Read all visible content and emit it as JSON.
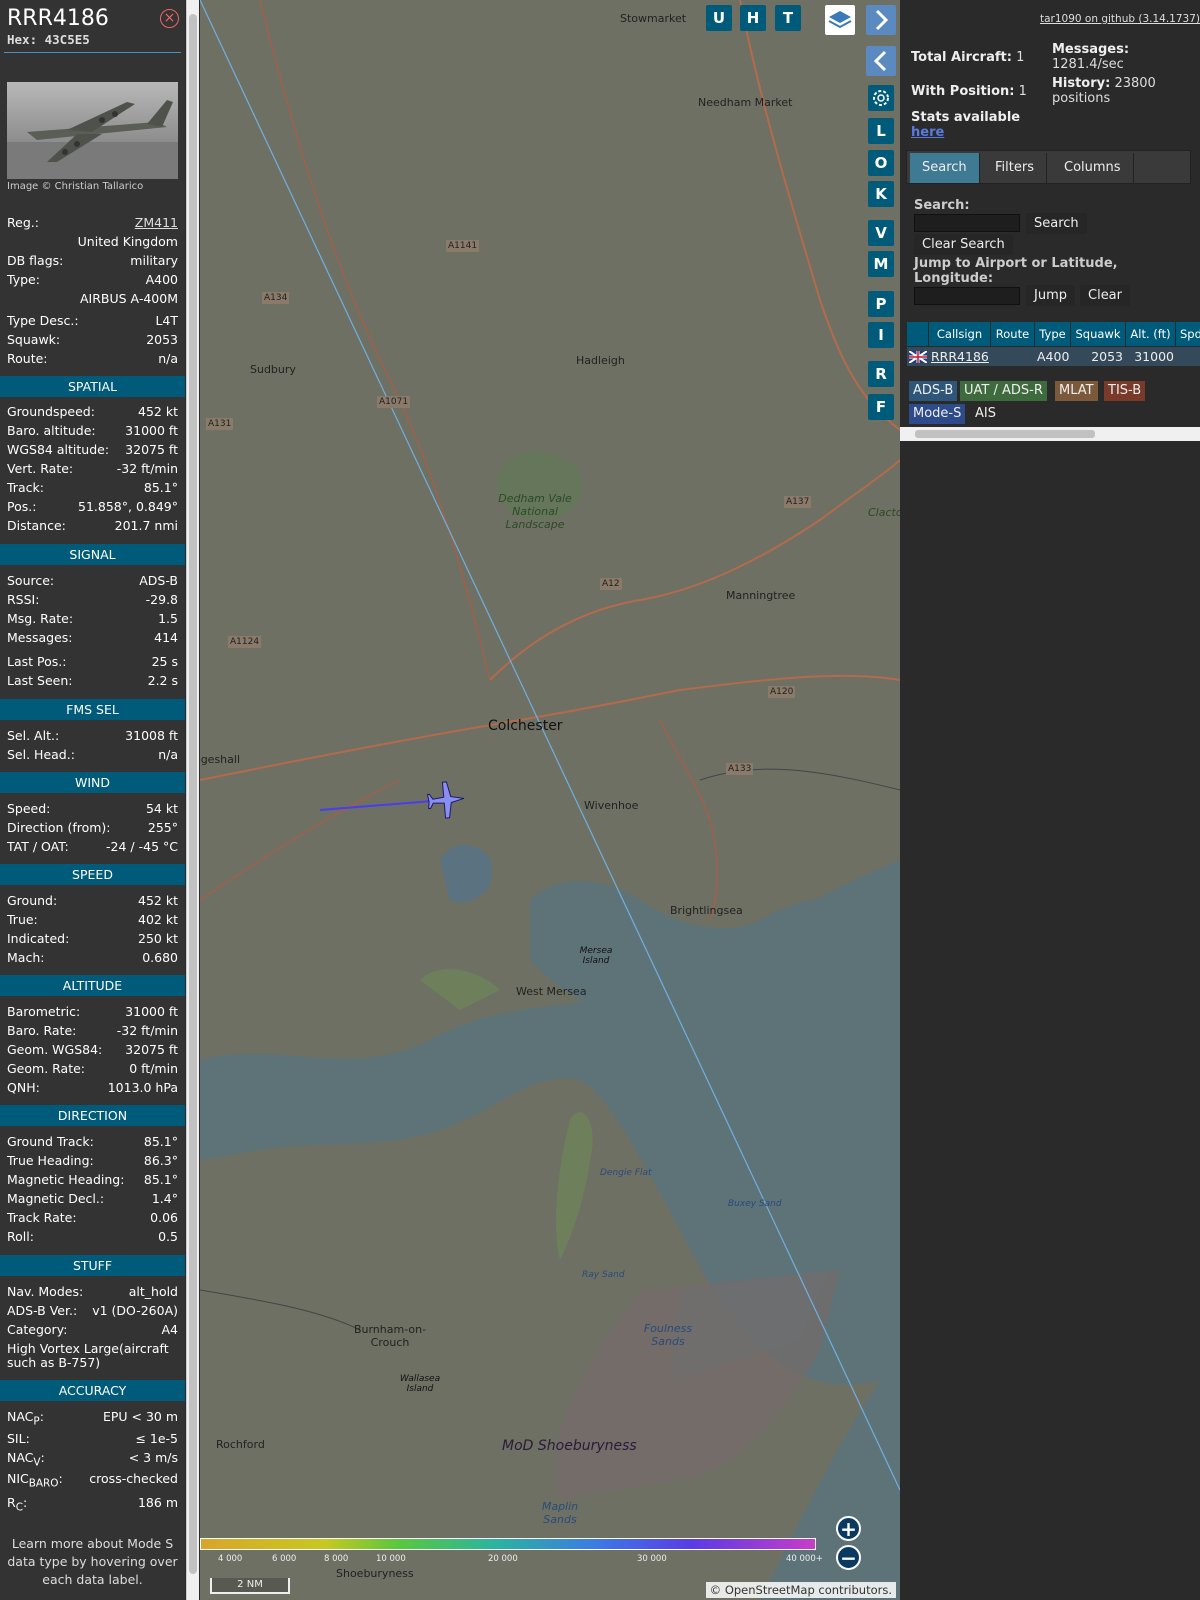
{
  "aircraft": {
    "callsign": "RRR4186",
    "hex": "Hex: 43C5E5",
    "close_symbol": "×",
    "photo_credit": "Image © Christian Tallarico",
    "reg_label": "Reg.:",
    "reg_value": "ZM411",
    "country": "United Kingdom",
    "dbflags_label": "DB flags:",
    "dbflags_value": "military",
    "type_label": "Type:",
    "type_value": "A400",
    "type_name": "AIRBUS A-400M",
    "typedesc_label": "Type Desc.:",
    "typedesc_value": "L4T",
    "squawk_label": "Squawk:",
    "squawk_value": "2053",
    "route_label": "Route:",
    "route_value": "n/a"
  },
  "sections": {
    "spatial": "SPATIAL",
    "signal": "SIGNAL",
    "fms": "FMS SEL",
    "wind": "WIND",
    "speed": "SPEED",
    "altitude": "ALTITUDE",
    "direction": "DIRECTION",
    "stuff": "STUFF",
    "accuracy": "ACCURACY"
  },
  "spatial": [
    [
      "Groundspeed:",
      "452 kt"
    ],
    [
      "Baro. altitude:",
      "31000 ft"
    ],
    [
      "WGS84 altitude:",
      "32075 ft"
    ],
    [
      "Vert. Rate:",
      "-32 ft/min"
    ],
    [
      "Track:",
      "85.1°"
    ],
    [
      "Pos.:",
      "51.858°, 0.849°"
    ],
    [
      "Distance:",
      "201.7 nmi"
    ]
  ],
  "signal": [
    [
      "Source:",
      "ADS-B"
    ],
    [
      "RSSI:",
      "-29.8"
    ],
    [
      "Msg. Rate:",
      "1.5"
    ],
    [
      "Messages:",
      "414"
    ],
    [
      "Last Pos.:",
      "25 s"
    ],
    [
      "Last Seen:",
      "2.2 s"
    ]
  ],
  "fms": [
    [
      "Sel. Alt.:",
      "31008 ft"
    ],
    [
      "Sel. Head.:",
      "n/a"
    ]
  ],
  "wind": [
    [
      "Speed:",
      "54 kt"
    ],
    [
      "Direction (from):",
      "255°"
    ],
    [
      "TAT / OAT:",
      "-24 / -45 °C"
    ]
  ],
  "speed": [
    [
      "Ground:",
      "452 kt"
    ],
    [
      "True:",
      "402 kt"
    ],
    [
      "Indicated:",
      "250 kt"
    ],
    [
      "Mach:",
      "0.680"
    ]
  ],
  "altitude": [
    [
      "Barometric:",
      "31000 ft"
    ],
    [
      "Baro. Rate:",
      "-32 ft/min"
    ],
    [
      "Geom. WGS84:",
      "32075 ft"
    ],
    [
      "Geom. Rate:",
      "0 ft/min"
    ],
    [
      "QNH:",
      "1013.0 hPa"
    ]
  ],
  "direction": [
    [
      "Ground Track:",
      "85.1°"
    ],
    [
      "True Heading:",
      "86.3°"
    ],
    [
      "Magnetic Heading:",
      "85.1°"
    ],
    [
      "Magnetic Decl.:",
      "1.4°"
    ],
    [
      "Track Rate:",
      "0.06"
    ],
    [
      "Roll:",
      "0.5"
    ]
  ],
  "stuff": {
    "rows": [
      [
        "Nav. Modes:",
        "alt_hold"
      ],
      [
        "ADS-B Ver.:",
        "v1 (DO-260A)"
      ],
      [
        "Category:",
        "A4"
      ]
    ],
    "category_desc": "High Vortex Large(aircraft such as B-757)"
  },
  "accuracy": {
    "nacp_label": "NAC",
    "nacp_sub": "P",
    "nacp_value": "EPU < 30 m",
    "sil_label": "SIL:",
    "sil_value": "≤ 1e-5",
    "nacv_label": "NAC",
    "nacv_sub": "V",
    "nacv_value": "< 3 m/s",
    "nicbaro_label": "NIC",
    "nicbaro_sub": "BARO",
    "nicbaro_value": "cross-checked",
    "rc_label": "R",
    "rc_sub": "C",
    "rc_value": "186 m"
  },
  "learn_more": "Learn more about Mode S data type by hovering over each data label.",
  "map": {
    "top_buttons": [
      "U",
      "H",
      "T"
    ],
    "side_buttons": [
      "L",
      "O",
      "K",
      "V",
      "M",
      "P",
      "I",
      "R",
      "F"
    ],
    "scale": "2 NM",
    "attribution": "© OpenStreetMap contributors.",
    "zoom_in": "+",
    "zoom_out": "−",
    "legend_ticks": [
      "4 000",
      "6 000",
      "8 000",
      "10 000",
      "20 000",
      "30 000",
      "40 000+"
    ],
    "places": [
      "Stowmarket",
      "Needham Market",
      "Hadleigh",
      "Sudbury",
      "Dedham Vale National Landscape",
      "Manningtree",
      "Colchester",
      "Wivenhoe",
      "Brightlingsea",
      "Mersea Island",
      "West Mersea",
      "Clacton-on-Sea",
      "Burnham-on-Crouch",
      "Wallasea Island",
      "Rochford",
      "MoD Shoeburyness",
      "Foulness Sands",
      "Maplin Sands",
      "Buxey Sand",
      "Ray Sand",
      "Dengie Flat",
      "Shoeburyness",
      "Coggeshall"
    ],
    "roads": [
      "A1141",
      "A134",
      "A131",
      "A1071",
      "A12",
      "A1124",
      "A120",
      "A133",
      "A137"
    ],
    "colors": {
      "track": "#4a3cf0",
      "legend": [
        "#d9a52a",
        "#c8c820",
        "#5ac83c",
        "#2ab4a0",
        "#3c78e6",
        "#5a3ce6",
        "#c83cc8"
      ]
    }
  },
  "stats": {
    "total_label": "Total Aircraft:",
    "total_value": "1",
    "withpos_label": "With Position:",
    "withpos_value": "1",
    "stats_label": "Stats available",
    "stats_link": "here",
    "messages_label": "Messages:",
    "messages_value": "1281.4/sec",
    "history_label": "History:",
    "history_value": "23800 positions",
    "github": "tar1090 on github (3.14.1737)"
  },
  "tabs": [
    "Search",
    "Filters",
    "Columns"
  ],
  "search": {
    "search_label": "Search:",
    "search_button": "Search",
    "clear_search": "Clear Search",
    "jump_label": "Jump to Airport or Latitude, Longitude:",
    "jump_button": "Jump",
    "clear_button": "Clear"
  },
  "table": {
    "headers": [
      "Callsign",
      "Route",
      "Type",
      "Squawk",
      "Alt. (ft)",
      "Spd"
    ],
    "row": {
      "callsign": "RRR4186",
      "route": "",
      "type": "A400",
      "squawk": "2053",
      "alt": "31000"
    }
  },
  "source_badges": [
    {
      "label": "ADS-B",
      "color": "#2d5678"
    },
    {
      "label": "UAT / ADS-R",
      "color": "#3e6b3e"
    },
    {
      "label": "MLAT",
      "color": "#7a5a3a"
    },
    {
      "label": "TIS-B",
      "color": "#7a3a2a"
    },
    {
      "label": "Mode-S",
      "color": "#2d4a8a"
    },
    {
      "label": "AIS",
      "color": "#2a2a2a"
    }
  ]
}
